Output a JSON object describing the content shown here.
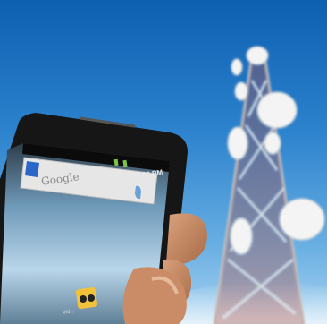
{
  "photo": {
    "subject": "smartphone-and-cell-tower",
    "sky_color": "#2c82cd",
    "phone_color": "#1a1a1a"
  },
  "phone_screen": {
    "status_time": "7:00 PM",
    "search_placeholder": "Google",
    "dock_label": "Vid..."
  }
}
